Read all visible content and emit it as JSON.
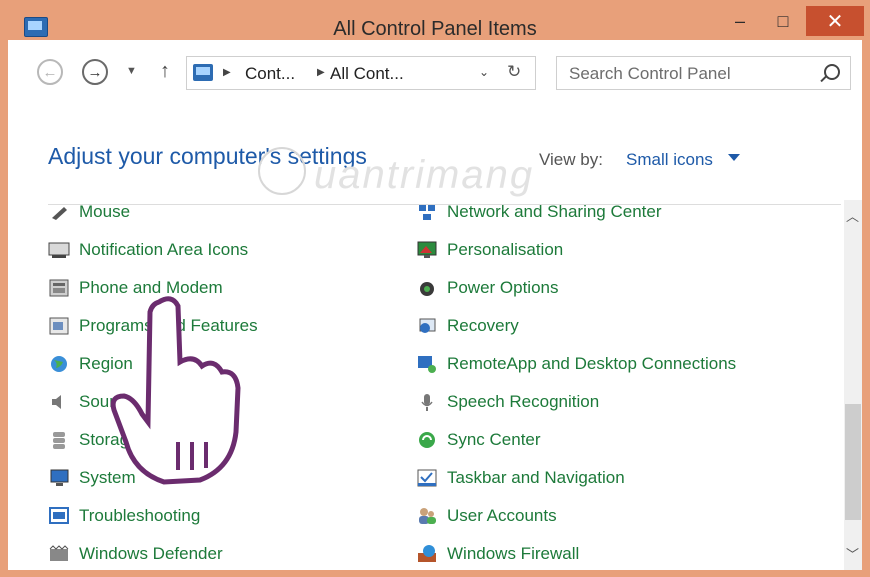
{
  "window": {
    "title": "All Control Panel Items"
  },
  "titlebar": {
    "minimize": "–",
    "maximize": "□",
    "close": "✕"
  },
  "nav": {
    "crumbs": [
      "Cont...",
      "All Cont..."
    ],
    "search_placeholder": "Search Control Panel"
  },
  "header": {
    "heading": "Adjust your computer's settings",
    "view_by_label": "View by:",
    "view_by_value": "Small icons"
  },
  "items_left": [
    {
      "label": "Mouse",
      "icon": "mouse-icon"
    },
    {
      "label": "Notification Area Icons",
      "icon": "notification-area-icon"
    },
    {
      "label": "Phone and Modem",
      "icon": "phone-modem-icon"
    },
    {
      "label": "Programs and Features",
      "icon": "programs-features-icon"
    },
    {
      "label": "Region",
      "icon": "region-globe-icon"
    },
    {
      "label": "Sound",
      "icon": "speaker-icon"
    },
    {
      "label": "Storag",
      "icon": "storage-icon"
    },
    {
      "label": "System",
      "icon": "system-monitor-icon"
    },
    {
      "label": "Troubleshooting",
      "icon": "troubleshooting-icon"
    },
    {
      "label": "Windows Defender",
      "icon": "defender-wall-icon"
    }
  ],
  "items_right": [
    {
      "label": "Network and Sharing Center",
      "icon": "network-icon"
    },
    {
      "label": "Personalisation",
      "icon": "personalisation-icon"
    },
    {
      "label": "Power Options",
      "icon": "power-options-icon"
    },
    {
      "label": "Recovery",
      "icon": "recovery-icon"
    },
    {
      "label": "RemoteApp and Desktop Connections",
      "icon": "remoteapp-icon"
    },
    {
      "label": "Speech Recognition",
      "icon": "microphone-icon"
    },
    {
      "label": "Sync Center",
      "icon": "sync-icon"
    },
    {
      "label": "Taskbar and Navigation",
      "icon": "taskbar-icon"
    },
    {
      "label": "User Accounts",
      "icon": "user-accounts-icon"
    },
    {
      "label": "Windows Firewall",
      "icon": "firewall-icon"
    }
  ],
  "watermark": {
    "text": "uantrimang"
  },
  "colors": {
    "title_accent": "#e8a07a",
    "close": "#c7502f",
    "link_green": "#1d7a3a",
    "heading_blue": "#1e5aa8"
  }
}
